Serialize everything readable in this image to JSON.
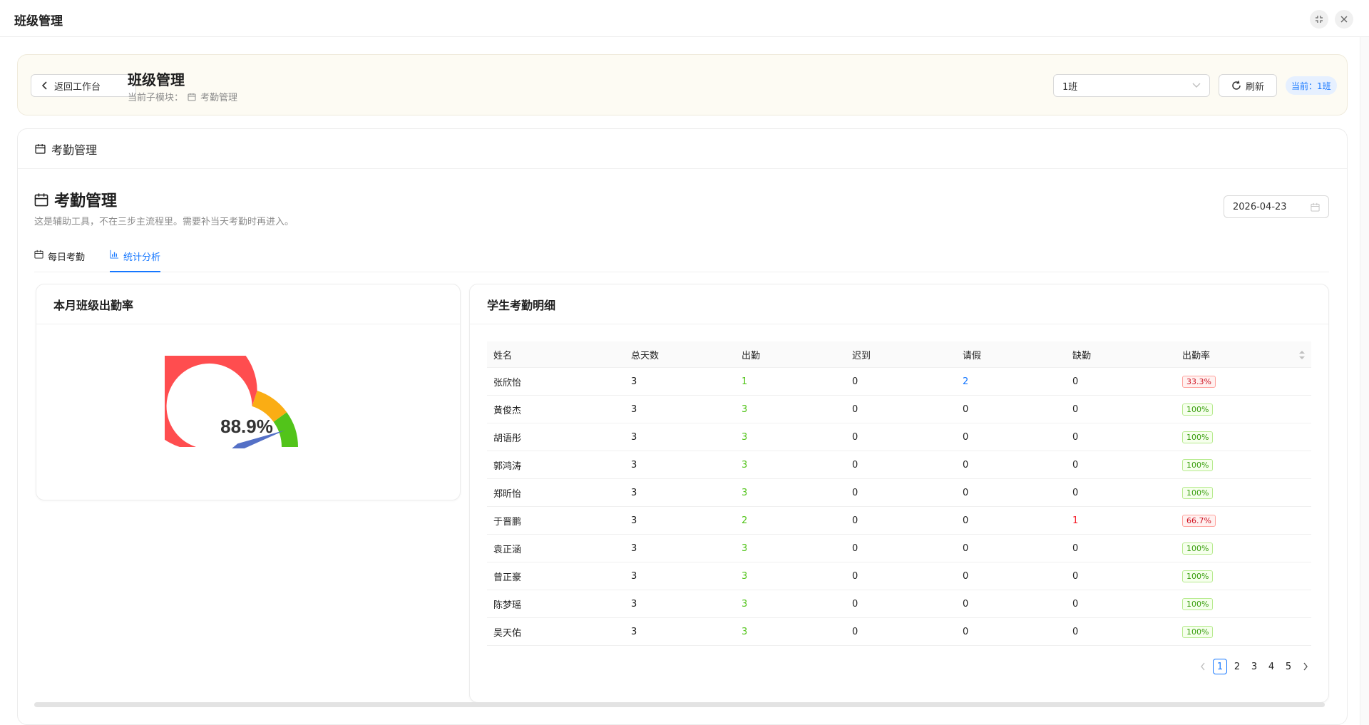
{
  "window": {
    "title": "班级管理"
  },
  "header": {
    "back_label": "返回工作台",
    "title": "班级管理",
    "sub_prefix": "当前子模块：",
    "sub_module": "考勤管理",
    "class_select_value": "1班",
    "refresh_label": "刷新",
    "current_tag": "当前：1班"
  },
  "main": {
    "card_title": "考勤管理",
    "section_title": "考勤管理",
    "section_desc": "这是辅助工具，不在三步主流程里。需要补当天考勤时再进入。",
    "date_value": "2026-04-23",
    "tabs": [
      {
        "label": "每日考勤",
        "active": false
      },
      {
        "label": "统计分析",
        "active": true
      }
    ]
  },
  "gauge": {
    "card_title": "本月班级出勤率",
    "value_label": "88.9%",
    "value": 88.9,
    "bands": [
      {
        "to": 60,
        "color": "#ff4d4f"
      },
      {
        "to": 80,
        "color": "#faad14"
      },
      {
        "to": 100,
        "color": "#52c41a"
      }
    ],
    "pointer_color": "#5470c6"
  },
  "table": {
    "card_title": "学生考勤明细",
    "columns": [
      "姓名",
      "总天数",
      "出勤",
      "迟到",
      "请假",
      "缺勤",
      "出勤率"
    ],
    "rows": [
      {
        "name": "张欣怡",
        "total": "3",
        "present": "1",
        "late": "0",
        "leave": "2",
        "absent": "0",
        "rate": "33.3%",
        "rate_ok": false
      },
      {
        "name": "黄俊杰",
        "total": "3",
        "present": "3",
        "late": "0",
        "leave": "0",
        "absent": "0",
        "rate": "100%",
        "rate_ok": true
      },
      {
        "name": "胡语彤",
        "total": "3",
        "present": "3",
        "late": "0",
        "leave": "0",
        "absent": "0",
        "rate": "100%",
        "rate_ok": true
      },
      {
        "name": "郭鸿涛",
        "total": "3",
        "present": "3",
        "late": "0",
        "leave": "0",
        "absent": "0",
        "rate": "100%",
        "rate_ok": true
      },
      {
        "name": "郑昕怡",
        "total": "3",
        "present": "3",
        "late": "0",
        "leave": "0",
        "absent": "0",
        "rate": "100%",
        "rate_ok": true
      },
      {
        "name": "于晋鹏",
        "total": "3",
        "present": "2",
        "late": "0",
        "leave": "0",
        "absent": "1",
        "rate": "66.7%",
        "rate_ok": false
      },
      {
        "name": "袁正涵",
        "total": "3",
        "present": "3",
        "late": "0",
        "leave": "0",
        "absent": "0",
        "rate": "100%",
        "rate_ok": true
      },
      {
        "name": "曾正豪",
        "total": "3",
        "present": "3",
        "late": "0",
        "leave": "0",
        "absent": "0",
        "rate": "100%",
        "rate_ok": true
      },
      {
        "name": "陈梦瑶",
        "total": "3",
        "present": "3",
        "late": "0",
        "leave": "0",
        "absent": "0",
        "rate": "100%",
        "rate_ok": true
      },
      {
        "name": "吴天佑",
        "total": "3",
        "present": "3",
        "late": "0",
        "leave": "0",
        "absent": "0",
        "rate": "100%",
        "rate_ok": true
      }
    ],
    "pages": [
      "1",
      "2",
      "3",
      "4",
      "5"
    ],
    "current_page": "1"
  }
}
